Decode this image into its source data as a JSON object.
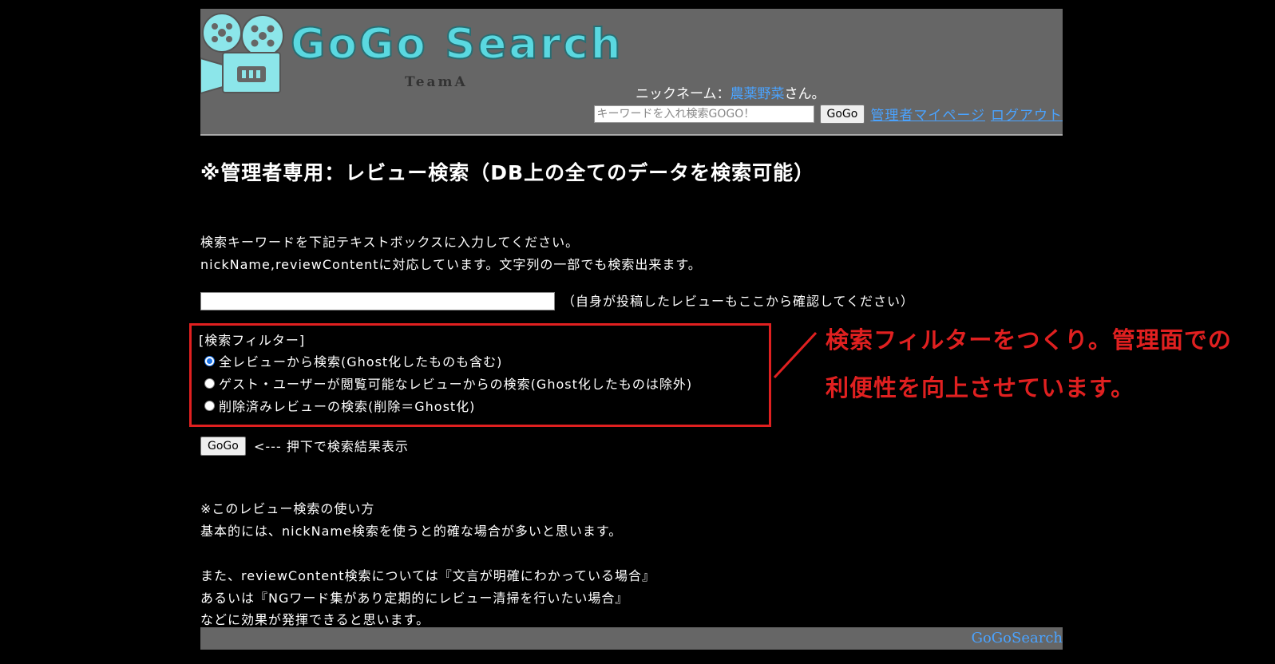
{
  "header": {
    "logo_text": "GoGo Search",
    "logo_sub": "TeamA",
    "nickname_prefix": "ニックネーム：",
    "nickname": "農薬野菜",
    "nickname_suffix": "さん。",
    "search_placeholder": "キーワードを入れ検索GOGO！",
    "search_button": "GoGo",
    "mypage_link": "管理者マイページ",
    "logout_link": "ログアウト",
    "icon": "movie-camera-icon"
  },
  "main": {
    "title": "※管理者専用：レビュー検索（DB上の全てのデータを検索可能）",
    "instruction_1": "検索キーワードを下記テキストボックスに入力してください。",
    "instruction_2": "nickName,reviewContentに対応しています。文字列の一部でも検索出来ます。",
    "keyword_value": "",
    "keyword_hint": "（自身が投稿したレビューもここから確認してください）",
    "filter_title": "[検索フィルター]",
    "filters": [
      {
        "label": "全レビューから検索(Ghost化したものも含む)",
        "checked": true
      },
      {
        "label": "ゲスト・ユーザーが閲覧可能なレビューからの検索(Ghost化したものは除外)",
        "checked": false
      },
      {
        "label": "削除済みレビューの検索(削除＝Ghost化)",
        "checked": false
      }
    ],
    "submit_button": "GoGo",
    "submit_hint": "<--- 押下で検索結果表示",
    "usage_title": "※このレビュー検索の使い方",
    "usage_1": "基本的には、nickName検索を使うと的確な場合が多いと思います。",
    "usage_2": "また、reviewContent検索については『文言が明確にわかっている場合』",
    "usage_3": "あるいは『NGワード集があり定期的にレビュー清掃を行いたい場合』",
    "usage_4": "などに効果が発揮できると思います。"
  },
  "annotation": {
    "line_1": "検索フィルターをつくり。管理面での",
    "line_2": "利便性を向上させています。",
    "color": "#e02020"
  },
  "footer": {
    "text": "GoGoSearch"
  },
  "colors": {
    "link": "#4aa3ff",
    "header_bg": "#666666",
    "logo": "#5ad8e0"
  }
}
